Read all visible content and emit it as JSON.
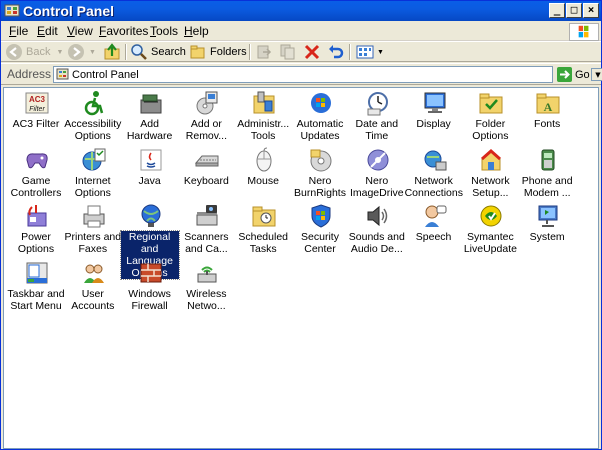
{
  "window": {
    "title": "Control Panel"
  },
  "menu": [
    "File",
    "Edit",
    "View",
    "Favorites",
    "Tools",
    "Help"
  ],
  "toolbar": {
    "back": "Back",
    "search": "Search",
    "folders": "Folders"
  },
  "address": {
    "label": "Address",
    "value": "Control Panel",
    "go": "Go"
  },
  "items": [
    {
      "label": "AC3 Filter",
      "icon": "ac3-filter-icon"
    },
    {
      "label": "Accessibility\nOptions",
      "icon": "accessibility-icon"
    },
    {
      "label": "Add\nHardware",
      "icon": "add-hardware-icon"
    },
    {
      "label": "Add or\nRemov...",
      "icon": "add-remove-programs-icon"
    },
    {
      "label": "Administr...\nTools",
      "icon": "administrative-tools-icon"
    },
    {
      "label": "Automatic\nUpdates",
      "icon": "automatic-updates-icon"
    },
    {
      "label": "Date and\nTime",
      "icon": "date-time-icon"
    },
    {
      "label": "Display",
      "icon": "display-icon"
    },
    {
      "label": "Folder\nOptions",
      "icon": "folder-options-icon"
    },
    {
      "label": "Fonts",
      "icon": "fonts-icon"
    },
    {
      "label": "Game\nControllers",
      "icon": "game-controllers-icon"
    },
    {
      "label": "Internet\nOptions",
      "icon": "internet-options-icon"
    },
    {
      "label": "Java",
      "icon": "java-icon"
    },
    {
      "label": "Keyboard",
      "icon": "keyboard-icon"
    },
    {
      "label": "Mouse",
      "icon": "mouse-icon"
    },
    {
      "label": "Nero\nBurnRights",
      "icon": "nero-burnrights-icon"
    },
    {
      "label": "Nero\nImageDrive",
      "icon": "nero-imagedrive-icon"
    },
    {
      "label": "Network\nConnections",
      "icon": "network-connections-icon"
    },
    {
      "label": "Network\nSetup...",
      "icon": "network-setup-icon"
    },
    {
      "label": "Phone and\nModem ...",
      "icon": "phone-modem-icon"
    },
    {
      "label": "Power\nOptions",
      "icon": "power-options-icon"
    },
    {
      "label": "Printers and\nFaxes",
      "icon": "printers-faxes-icon"
    },
    {
      "label": "Regional\nand\nLanguage\nOptions",
      "icon": "regional-language-icon",
      "selected": true
    },
    {
      "label": "Scanners\nand Ca...",
      "icon": "scanners-cameras-icon"
    },
    {
      "label": "Scheduled\nTasks",
      "icon": "scheduled-tasks-icon"
    },
    {
      "label": "Security\nCenter",
      "icon": "security-center-icon"
    },
    {
      "label": "Sounds and\nAudio De...",
      "icon": "sounds-audio-icon"
    },
    {
      "label": "Speech",
      "icon": "speech-icon"
    },
    {
      "label": "Symantec\nLiveUpdate",
      "icon": "symantec-liveupdate-icon"
    },
    {
      "label": "System",
      "icon": "system-icon"
    },
    {
      "label": "Taskbar and\nStart Menu",
      "icon": "taskbar-start-menu-icon"
    },
    {
      "label": "User\nAccounts",
      "icon": "user-accounts-icon"
    },
    {
      "label": "Windows\nFirewall",
      "icon": "windows-firewall-icon"
    },
    {
      "label": "Wireless\nNetwo...",
      "icon": "wireless-network-icon"
    }
  ]
}
